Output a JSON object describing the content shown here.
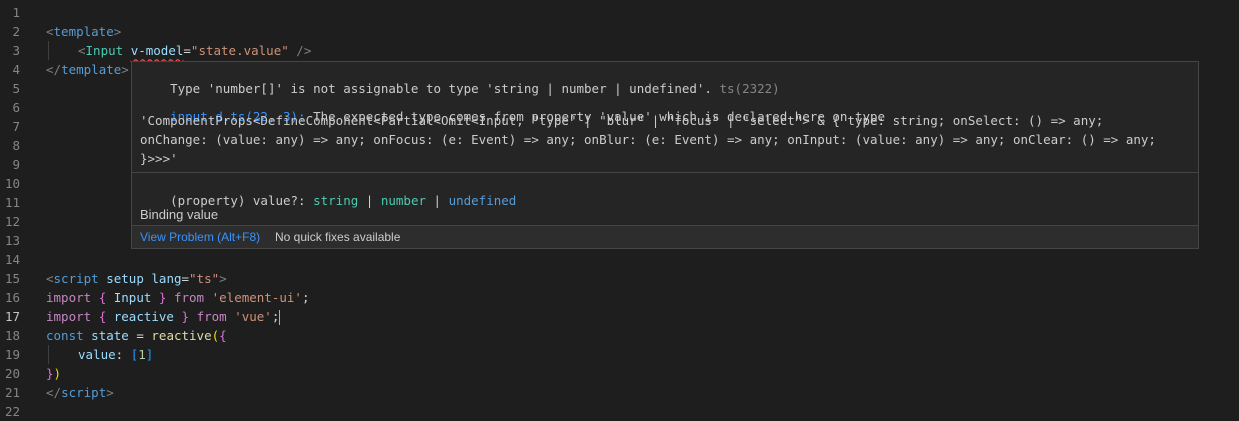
{
  "line_numbers": [
    "1",
    "2",
    "3",
    "4",
    "5",
    "6",
    "7",
    "8",
    "9",
    "10",
    "11",
    "12",
    "13",
    "14",
    "15",
    "16",
    "17",
    "18",
    "19",
    "20",
    "21",
    "22"
  ],
  "active_line": "17",
  "code": {
    "l2": {
      "lt": "<",
      "tag": "template",
      "gt": ">"
    },
    "l3": {
      "lt": "<",
      "comp": "Input",
      "attr": "v-model",
      "eq": "=",
      "val": "\"state.value\"",
      "close": " />"
    },
    "l4": {
      "lt": "</",
      "tag": "template",
      "gt": ">"
    },
    "l15": {
      "lt": "<",
      "tag": "script",
      "attr1": "setup",
      "attr2": "lang",
      "eq": "=",
      "val": "\"ts\"",
      "gt": ">"
    },
    "l16": {
      "kw": "import",
      "ob": "{",
      "name": "Input",
      "cb": "}",
      "from": "from",
      "src": "'element-ui'",
      "semi": ";"
    },
    "l17": {
      "kw": "import",
      "ob": "{",
      "name": "reactive",
      "cb": "}",
      "from": "from",
      "src": "'vue'",
      "semi": ";"
    },
    "l18": {
      "kw": "const",
      "name": "state",
      "eq": "=",
      "fn": "reactive",
      "op": "(",
      "ob": "{"
    },
    "l19": {
      "key": "value",
      "colon": ":",
      "ob": "[",
      "num": "1",
      "cb": "]"
    },
    "l20": {
      "cb": "}",
      "cp": ")"
    },
    "l21": {
      "lt": "</",
      "tag": "script",
      "gt": ">"
    }
  },
  "hover": {
    "error_message": "Type 'number[]' is not assignable to type 'string | number | undefined'.",
    "error_code": "ts(2322)",
    "related_link": "input.d.ts(22, 3):",
    "related_text_1": " The expected type comes from property 'value' which is declared here on type",
    "related_text_2": "'ComponentProps<DefineComponent<Partial<Omit<Input, \"type\" | \"blur\" | \"focus\" | \"select\"> & { type: string; onSelect: () => any;",
    "related_text_3": "onChange: (value: any) => any; onFocus: (e: Event) => any; onBlur: (e: Event) => any; onInput: (value: any) => any; onClear: () => any;",
    "related_text_4": "}>>>'",
    "prop_prefix": "(property) value?: ",
    "prop_type1": "string",
    "prop_sep1": " | ",
    "prop_type2": "number",
    "prop_sep2": " | ",
    "prop_type3": "undefined",
    "doc": "Binding value",
    "view_problem": "View Problem (Alt+F8)",
    "no_fixes": "No quick fixes available"
  }
}
